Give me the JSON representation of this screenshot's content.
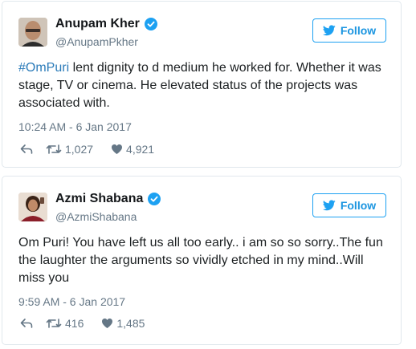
{
  "tweets": [
    {
      "name": "Anupam Kher",
      "handle": "@AnupamPkher",
      "follow_label": "Follow",
      "hashtag": "#OmPuri",
      "text": " lent dignity to d medium he worked for. Whether it was stage, TV or cinema. He elevated status of the projects was associated with.",
      "timestamp": "10:24 AM - 6 Jan 2017",
      "retweets": "1,027",
      "likes": "4,921",
      "verified": true,
      "icons": [
        "avatar",
        "verified-icon",
        "bird-icon",
        "reply-icon",
        "retweet-icon",
        "heart-icon"
      ]
    },
    {
      "name": "Azmi Shabana",
      "handle": "@AzmiShabana",
      "follow_label": "Follow",
      "hashtag": "",
      "text": "Om Puri! You have left us all too early.. i am so so sorry..The fun the laughter the arguments so vividly etched in my mind..Will miss you",
      "timestamp": "9:59 AM - 6 Jan 2017",
      "retweets": "416",
      "likes": "1,485",
      "verified": true,
      "icons": [
        "avatar",
        "verified-icon",
        "bird-icon",
        "reply-icon",
        "retweet-icon",
        "heart-icon"
      ]
    }
  ],
  "colors": {
    "accent": "#1da1f2",
    "link": "#2b7bb9",
    "text": "#1c2022",
    "muted": "#657786",
    "border": "#e1e8ed"
  }
}
